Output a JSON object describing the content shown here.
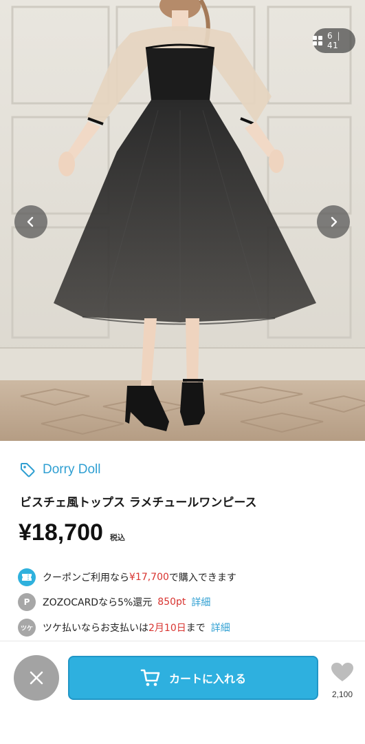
{
  "gallery": {
    "image": "product-photo-dress-model",
    "counter": {
      "current": "6",
      "separator": "|",
      "total": "41",
      "icon": "grid-icon"
    },
    "prev_icon": "chevron-left-icon",
    "next_icon": "chevron-right-icon"
  },
  "product": {
    "brand": "Dorry Doll",
    "brand_icon": "tag-icon",
    "title": "ビスチェ風トップス ラメチュールワンピース",
    "price": "¥18,700",
    "tax_label": "税込"
  },
  "benefits": {
    "coupon": {
      "icon": "coupon-icon",
      "prefix": "クーポンご利用なら",
      "amount": "¥17,700",
      "suffix": "で購入できます"
    },
    "zozocard": {
      "icon_text": "P",
      "prefix": "ZOZOCARDなら5%還元",
      "points": "850pt",
      "link": "詳細"
    },
    "tsuke": {
      "icon_text": "ツケ",
      "prefix": "ツケ払いならお支払いは",
      "date": "2月10日",
      "suffix": "まで",
      "link": "詳細"
    }
  },
  "actions": {
    "close_icon": "close-icon",
    "cart_icon": "cart-icon",
    "cart_label": "カートに入れる",
    "favorite_icon": "heart-icon",
    "favorite_count": "2,100"
  },
  "colors": {
    "accent": "#2eb0df",
    "brand_text": "#2f9fd2",
    "sale_red": "#d8332f",
    "muted_gray": "#a3a3a3"
  }
}
